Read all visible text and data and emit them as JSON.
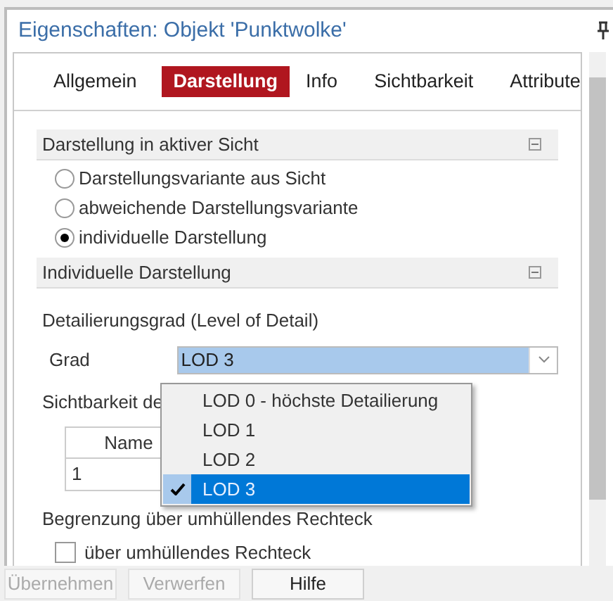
{
  "window": {
    "title": "Eigenschaften: Objekt 'Punktwolke'"
  },
  "tabs": [
    {
      "label": "Allgemein",
      "selected": false
    },
    {
      "label": "Darstellung",
      "selected": true
    },
    {
      "label": "Info",
      "selected": false
    },
    {
      "label": "Sichtbarkeit",
      "selected": false
    },
    {
      "label": "Attribute",
      "selected": false
    }
  ],
  "section_1": {
    "title": "Darstellung in aktiver Sicht",
    "expanded": true,
    "options": [
      {
        "label": "Darstellungsvariante aus Sicht",
        "selected": false
      },
      {
        "label": "abweichende Darstellungsvariante",
        "selected": false
      },
      {
        "label": "individuelle Darstellung",
        "selected": true
      }
    ]
  },
  "section_2": {
    "title": "Individuelle Darstellung",
    "expanded": true,
    "detail_label": "Detailierungsgrad (Level of Detail)",
    "grade": {
      "label": "Grad",
      "value": "LOD 3",
      "open": true,
      "options": [
        {
          "label": "LOD 0 - höchste Detailierung",
          "selected": false
        },
        {
          "label": "LOD 1",
          "selected": false
        },
        {
          "label": "LOD 2",
          "selected": false
        },
        {
          "label": "LOD 3",
          "selected": true
        }
      ]
    },
    "visibility_label": "Sichtbarkeit de",
    "table": {
      "columns": [
        "Name"
      ],
      "rows": [
        [
          "1"
        ]
      ]
    },
    "bounds_label": "Begrenzung über umhüllendes Rechteck",
    "bounds_checkbox": {
      "label": "über umhüllendes Rechteck",
      "checked": false
    }
  },
  "buttons": [
    {
      "label": "Übernehmen",
      "disabled": true
    },
    {
      "label": "Verwerfen",
      "disabled": true
    },
    {
      "label": "Hilfe",
      "disabled": false
    }
  ]
}
